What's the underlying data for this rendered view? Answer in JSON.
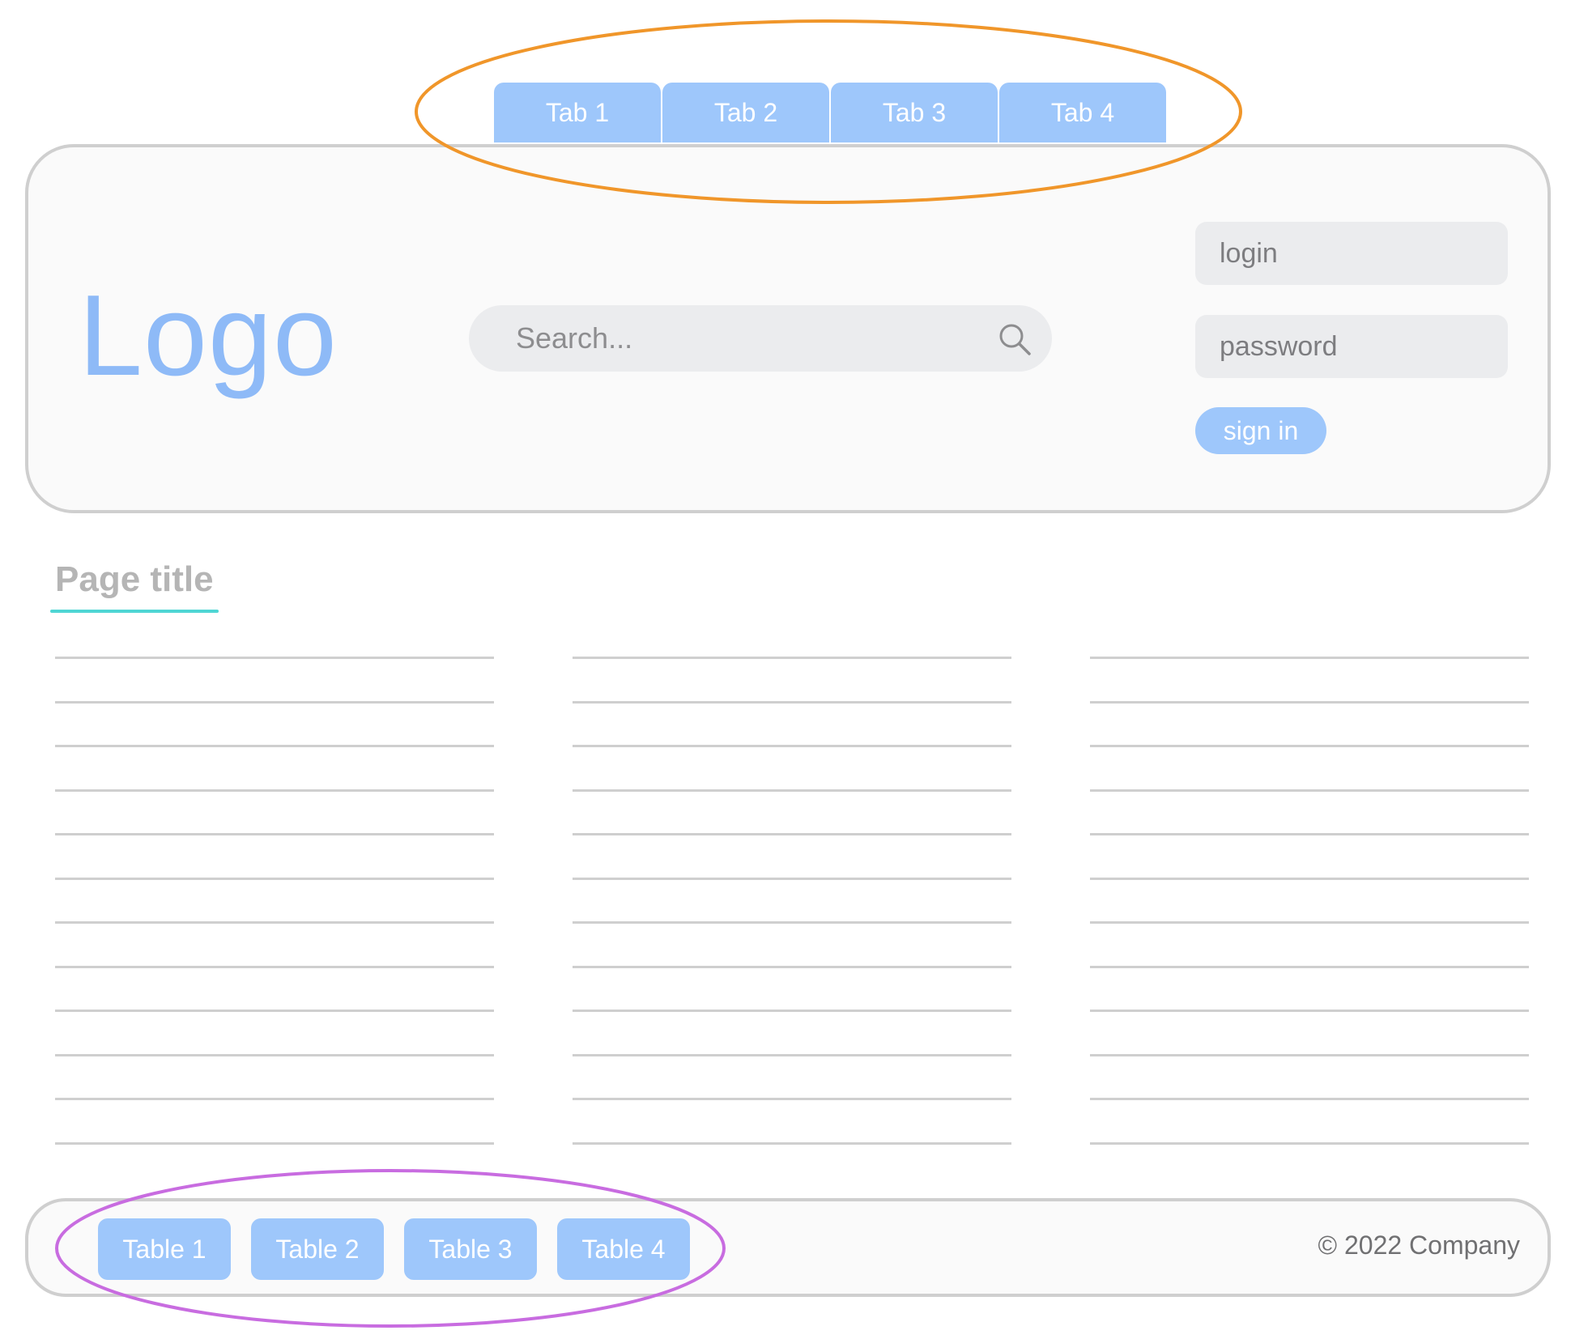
{
  "tabs": [
    {
      "label": "Tab 1"
    },
    {
      "label": "Tab 2"
    },
    {
      "label": "Tab 3"
    },
    {
      "label": "Tab 4"
    }
  ],
  "header": {
    "logo_text": "Logo",
    "search": {
      "placeholder": "Search..."
    },
    "login": {
      "placeholder": "login"
    },
    "password": {
      "placeholder": "password"
    },
    "signin_label": "sign in"
  },
  "page": {
    "title": "Page title",
    "columns": 3,
    "lines_per_column": 12
  },
  "footer": {
    "tables": [
      {
        "label": "Table 1"
      },
      {
        "label": "Table 2"
      },
      {
        "label": "Table 3"
      },
      {
        "label": "Table 4"
      }
    ],
    "copyright": "© 2022 Company"
  },
  "colors": {
    "accent_blue": "#9ec7fb",
    "logo_blue": "#8ebaf7",
    "title_underline": "#4fd6d4",
    "tabs_annotation": "#f0962a",
    "tables_annotation": "#c86ce0",
    "border_gray": "#cfcfcf"
  }
}
